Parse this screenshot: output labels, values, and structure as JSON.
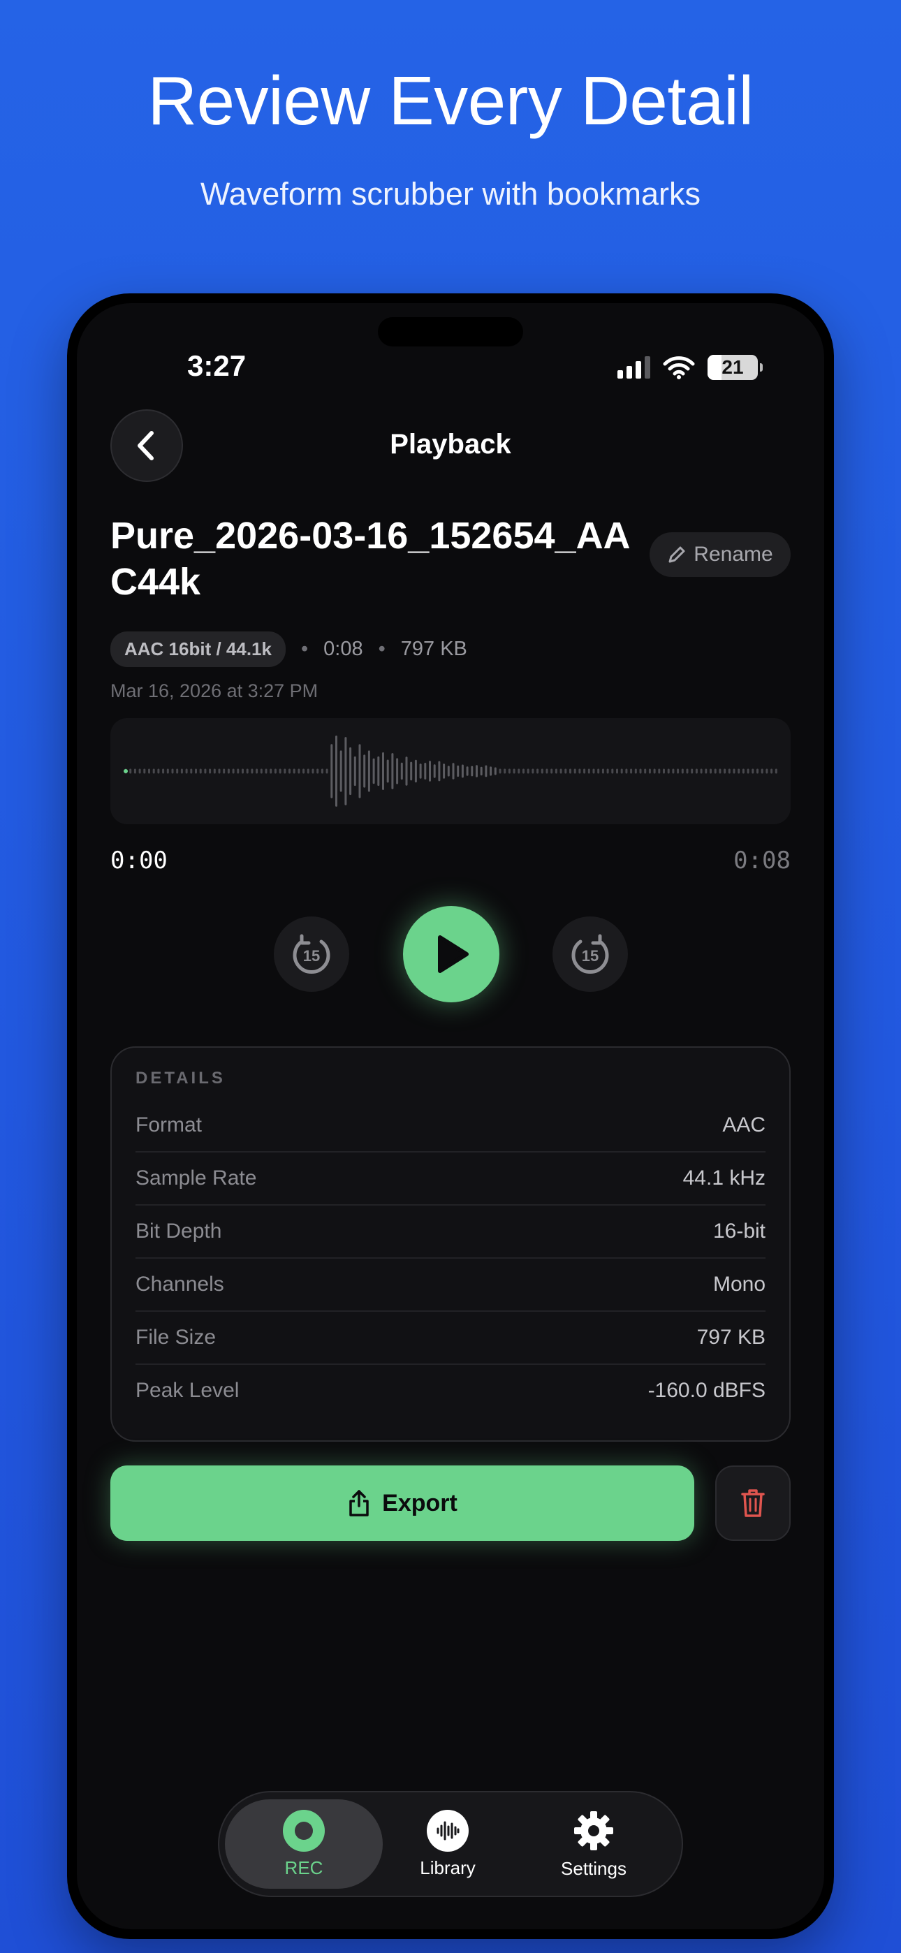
{
  "promo": {
    "headline": "Review Every Detail",
    "subhead": "Waveform scrubber with bookmarks"
  },
  "status_bar": {
    "time": "3:27",
    "battery": "21"
  },
  "nav": {
    "title": "Playback",
    "back_icon": "chevron-left-icon"
  },
  "recording": {
    "title": "Pure_2026-03-16_152654_AAC44k",
    "rename_label": "Rename",
    "format_badge": "AAC 16bit / 44.1k",
    "duration": "0:08",
    "size": "797 KB",
    "date": "Mar 16, 2026 at 3:27 PM"
  },
  "player": {
    "current_time": "0:00",
    "total_time": "0:08",
    "skip_back_label": "15",
    "skip_forward_label": "15",
    "progress": 0.0
  },
  "details": {
    "label": "DETAILS",
    "rows": [
      {
        "key": "Format",
        "value": "AAC"
      },
      {
        "key": "Sample Rate",
        "value": "44.1 kHz"
      },
      {
        "key": "Bit Depth",
        "value": "16-bit"
      },
      {
        "key": "Channels",
        "value": "Mono"
      },
      {
        "key": "File Size",
        "value": "797 KB"
      },
      {
        "key": "Peak Level",
        "value": "-160.0 dBFS"
      }
    ]
  },
  "actions": {
    "export_label": "Export"
  },
  "tabbar": {
    "tabs": [
      {
        "label": "REC",
        "icon": "record-icon",
        "active": true
      },
      {
        "label": "Library",
        "icon": "waveform-icon",
        "active": false
      },
      {
        "label": "Settings",
        "icon": "gear-icon",
        "active": false
      }
    ]
  },
  "colors": {
    "background": "#2563e6",
    "accent": "#6bd38c",
    "screen": "#0b0b0d",
    "danger": "#e0554f"
  }
}
